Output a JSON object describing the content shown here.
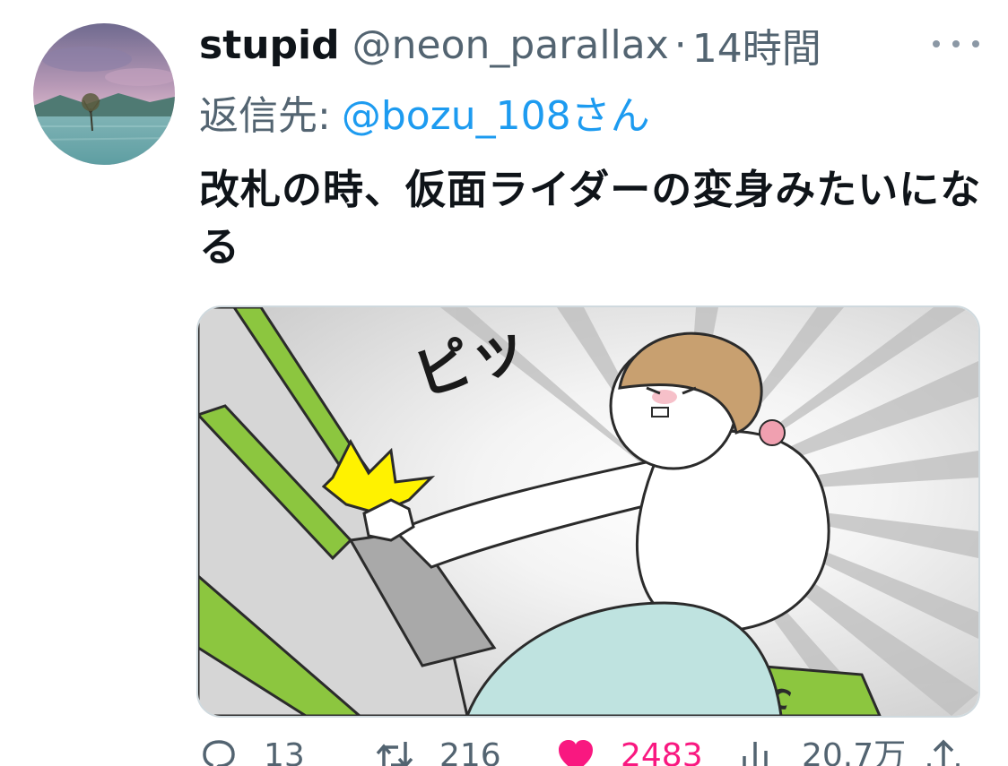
{
  "tweet": {
    "display_name": "stupid",
    "handle": "@neon_parallax",
    "separator": "·",
    "time": "14時間",
    "reply_prefix": "返信先:",
    "reply_to": "@bozu_108さん",
    "text": "改札の時、仮面ライダーの変身みたいになる"
  },
  "media": {
    "sfx_text": "ピッ",
    "card_label": "IC"
  },
  "actions": {
    "reply_count": "13",
    "retweet_count": "216",
    "like_count": "2483",
    "views_count": "20.7万"
  },
  "icons": {
    "more": "more-dots-icon",
    "reply": "reply-bubble-icon",
    "retweet": "retweet-arrows-icon",
    "like": "heart-icon",
    "views": "views-bars-icon",
    "share": "share-arrow-icon"
  },
  "colors": {
    "text_primary": "#0f1419",
    "text_secondary": "#536471",
    "link": "#1d9bf0",
    "like": "#f91880",
    "gate_green": "#8cc63f"
  }
}
